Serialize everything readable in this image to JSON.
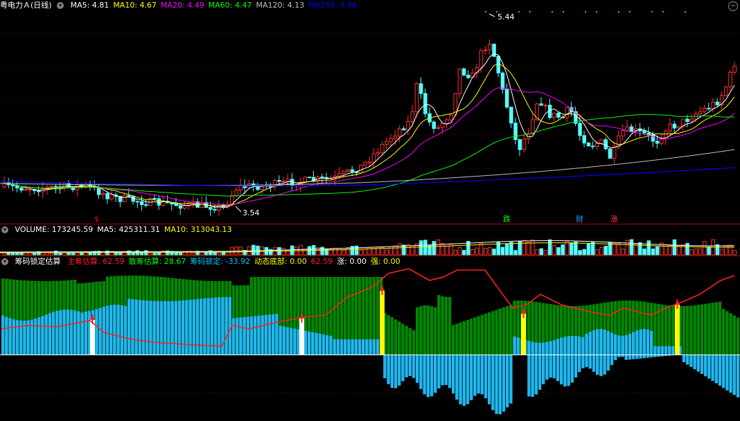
{
  "header": {
    "title": "粤电力Ａ(日线)",
    "ma": [
      {
        "label": "MA5: 4.81",
        "color": "#ffffff"
      },
      {
        "label": "MA10: 4.67",
        "color": "#ffff00"
      },
      {
        "label": "MA20: 4.49",
        "color": "#ff00ff"
      },
      {
        "label": "MA60: 4.47",
        "color": "#00ff00"
      },
      {
        "label": "MA120: 4.13",
        "color": "#c0c0c0"
      },
      {
        "label": "MA250: 3.96",
        "color": "#0000ff"
      }
    ],
    "corner_icon": "collapse-icon"
  },
  "volume_header": {
    "items": [
      {
        "label": "VOLUME: 173245.59",
        "color": "#ffffff"
      },
      {
        "label": "MA5: 425311.31",
        "color": "#ffffff"
      },
      {
        "label": "MA10: 313043.13",
        "color": "#ffff00"
      }
    ]
  },
  "indicator_header": {
    "name": "筹码锁定估算",
    "items": [
      {
        "label": "主筹估算: 62.59",
        "color": "#ff2020"
      },
      {
        "label": "散筹估算: 28.67",
        "color": "#00ff00"
      },
      {
        "label": "筹码锁定: -33.92",
        "color": "#00c8ff"
      },
      {
        "label": "动态底部: 0.00",
        "color": "#ffff00"
      },
      {
        "label": "62.59",
        "color": "#ff2020"
      },
      {
        "label": "涨: 0.00",
        "color": "#ffffff"
      },
      {
        "label": "强: 0.00",
        "color": "#ffff00"
      }
    ]
  },
  "chart_data": {
    "type": "candlestick",
    "price_annotations": [
      {
        "label": "5.44",
        "kind": "high"
      },
      {
        "label": "3.54",
        "kind": "low"
      }
    ],
    "event_markers": [
      {
        "label": "$",
        "color": "#ff0000"
      },
      {
        "label": "跌",
        "color": "#00ff00"
      },
      {
        "label": "财",
        "color": "#00aaff"
      },
      {
        "label": "涨",
        "color": "#ff4040"
      }
    ],
    "ylim": [
      3.5,
      5.5
    ],
    "colors": {
      "up": "#ff3030",
      "down": "#54ffff",
      "ma5": "#ffffff",
      "ma10": "#ffff00",
      "ma20": "#ff00ff",
      "ma60": "#00ff00",
      "ma120": "#c0c0c0",
      "ma250": "#0000ff",
      "indicator_main": "#ff2020",
      "indicator_green": "#008800",
      "indicator_blue": "#1fb8f0",
      "indicator_marker": "#ffff00"
    }
  }
}
